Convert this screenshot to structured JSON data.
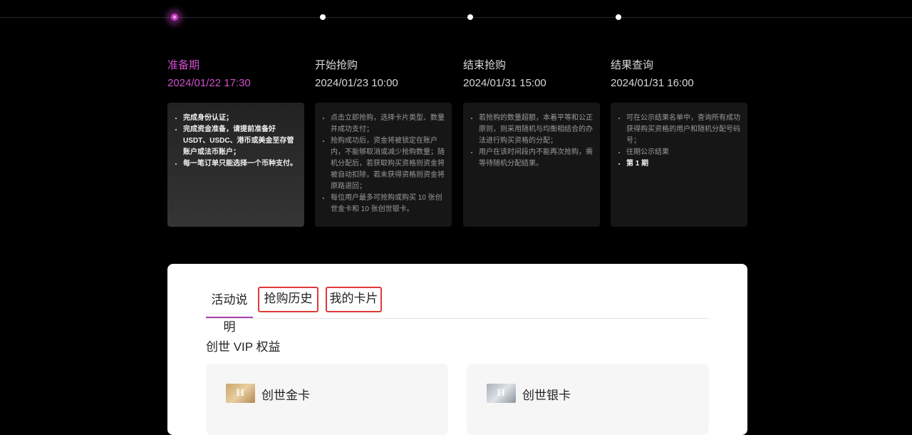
{
  "colors": {
    "accent": "#d14fcc",
    "background": "#000000",
    "panel": "#ffffff",
    "highlight_box": "#e03a3a"
  },
  "stages": [
    {
      "title": "准备期",
      "date": "2024/01/22 17:30",
      "active": true,
      "items": [
        "完成身份认证；",
        "完成资金准备，请提前准备好 USDT、USDC、港币或美金至存管账户或法币账户；",
        "每一笔订单只能选择一个币种支付。"
      ]
    },
    {
      "title": "开始抢购",
      "date": "2024/01/23 10:00",
      "active": false,
      "items": [
        "点击立即抢购，选择卡片类型、数量并成功支付；",
        "抢购成功后，资金将被锁定在账户内，不能够取消或减少抢购数量；随机分配后，若获取购买资格则资金将被自动扣除，若未获得资格则资金将原路退回；",
        "每位用户最多可抢购或购买 10 张创世金卡和 10 张创世银卡。"
      ]
    },
    {
      "title": "结束抢购",
      "date": "2024/01/31 15:00",
      "active": false,
      "items": [
        "若抢购的数量超额，本着平等和公正原则，则采用随机与均衡相结合的办法进行购买资格的分配；",
        "用户在该时间段内不能再次抢购，需等待随机分配结果。"
      ]
    },
    {
      "title": "结果查询",
      "date": "2024/01/31 16:00",
      "active": false,
      "items": [
        "可在公示结果名单中，查询所有成功获得购买资格的用户和随机分配号码号；",
        "往期公示结果",
        "第 1 期"
      ]
    }
  ],
  "tabs": [
    {
      "label": "活动说明",
      "active": true
    },
    {
      "label": "抢购历史",
      "active": false
    },
    {
      "label": "我的卡片",
      "active": false
    }
  ],
  "section_title": "创世 VIP 权益",
  "benefits": [
    {
      "name": "创世金卡",
      "icon": "gold-card-icon"
    },
    {
      "name": "创世银卡",
      "icon": "silver-card-icon"
    }
  ]
}
